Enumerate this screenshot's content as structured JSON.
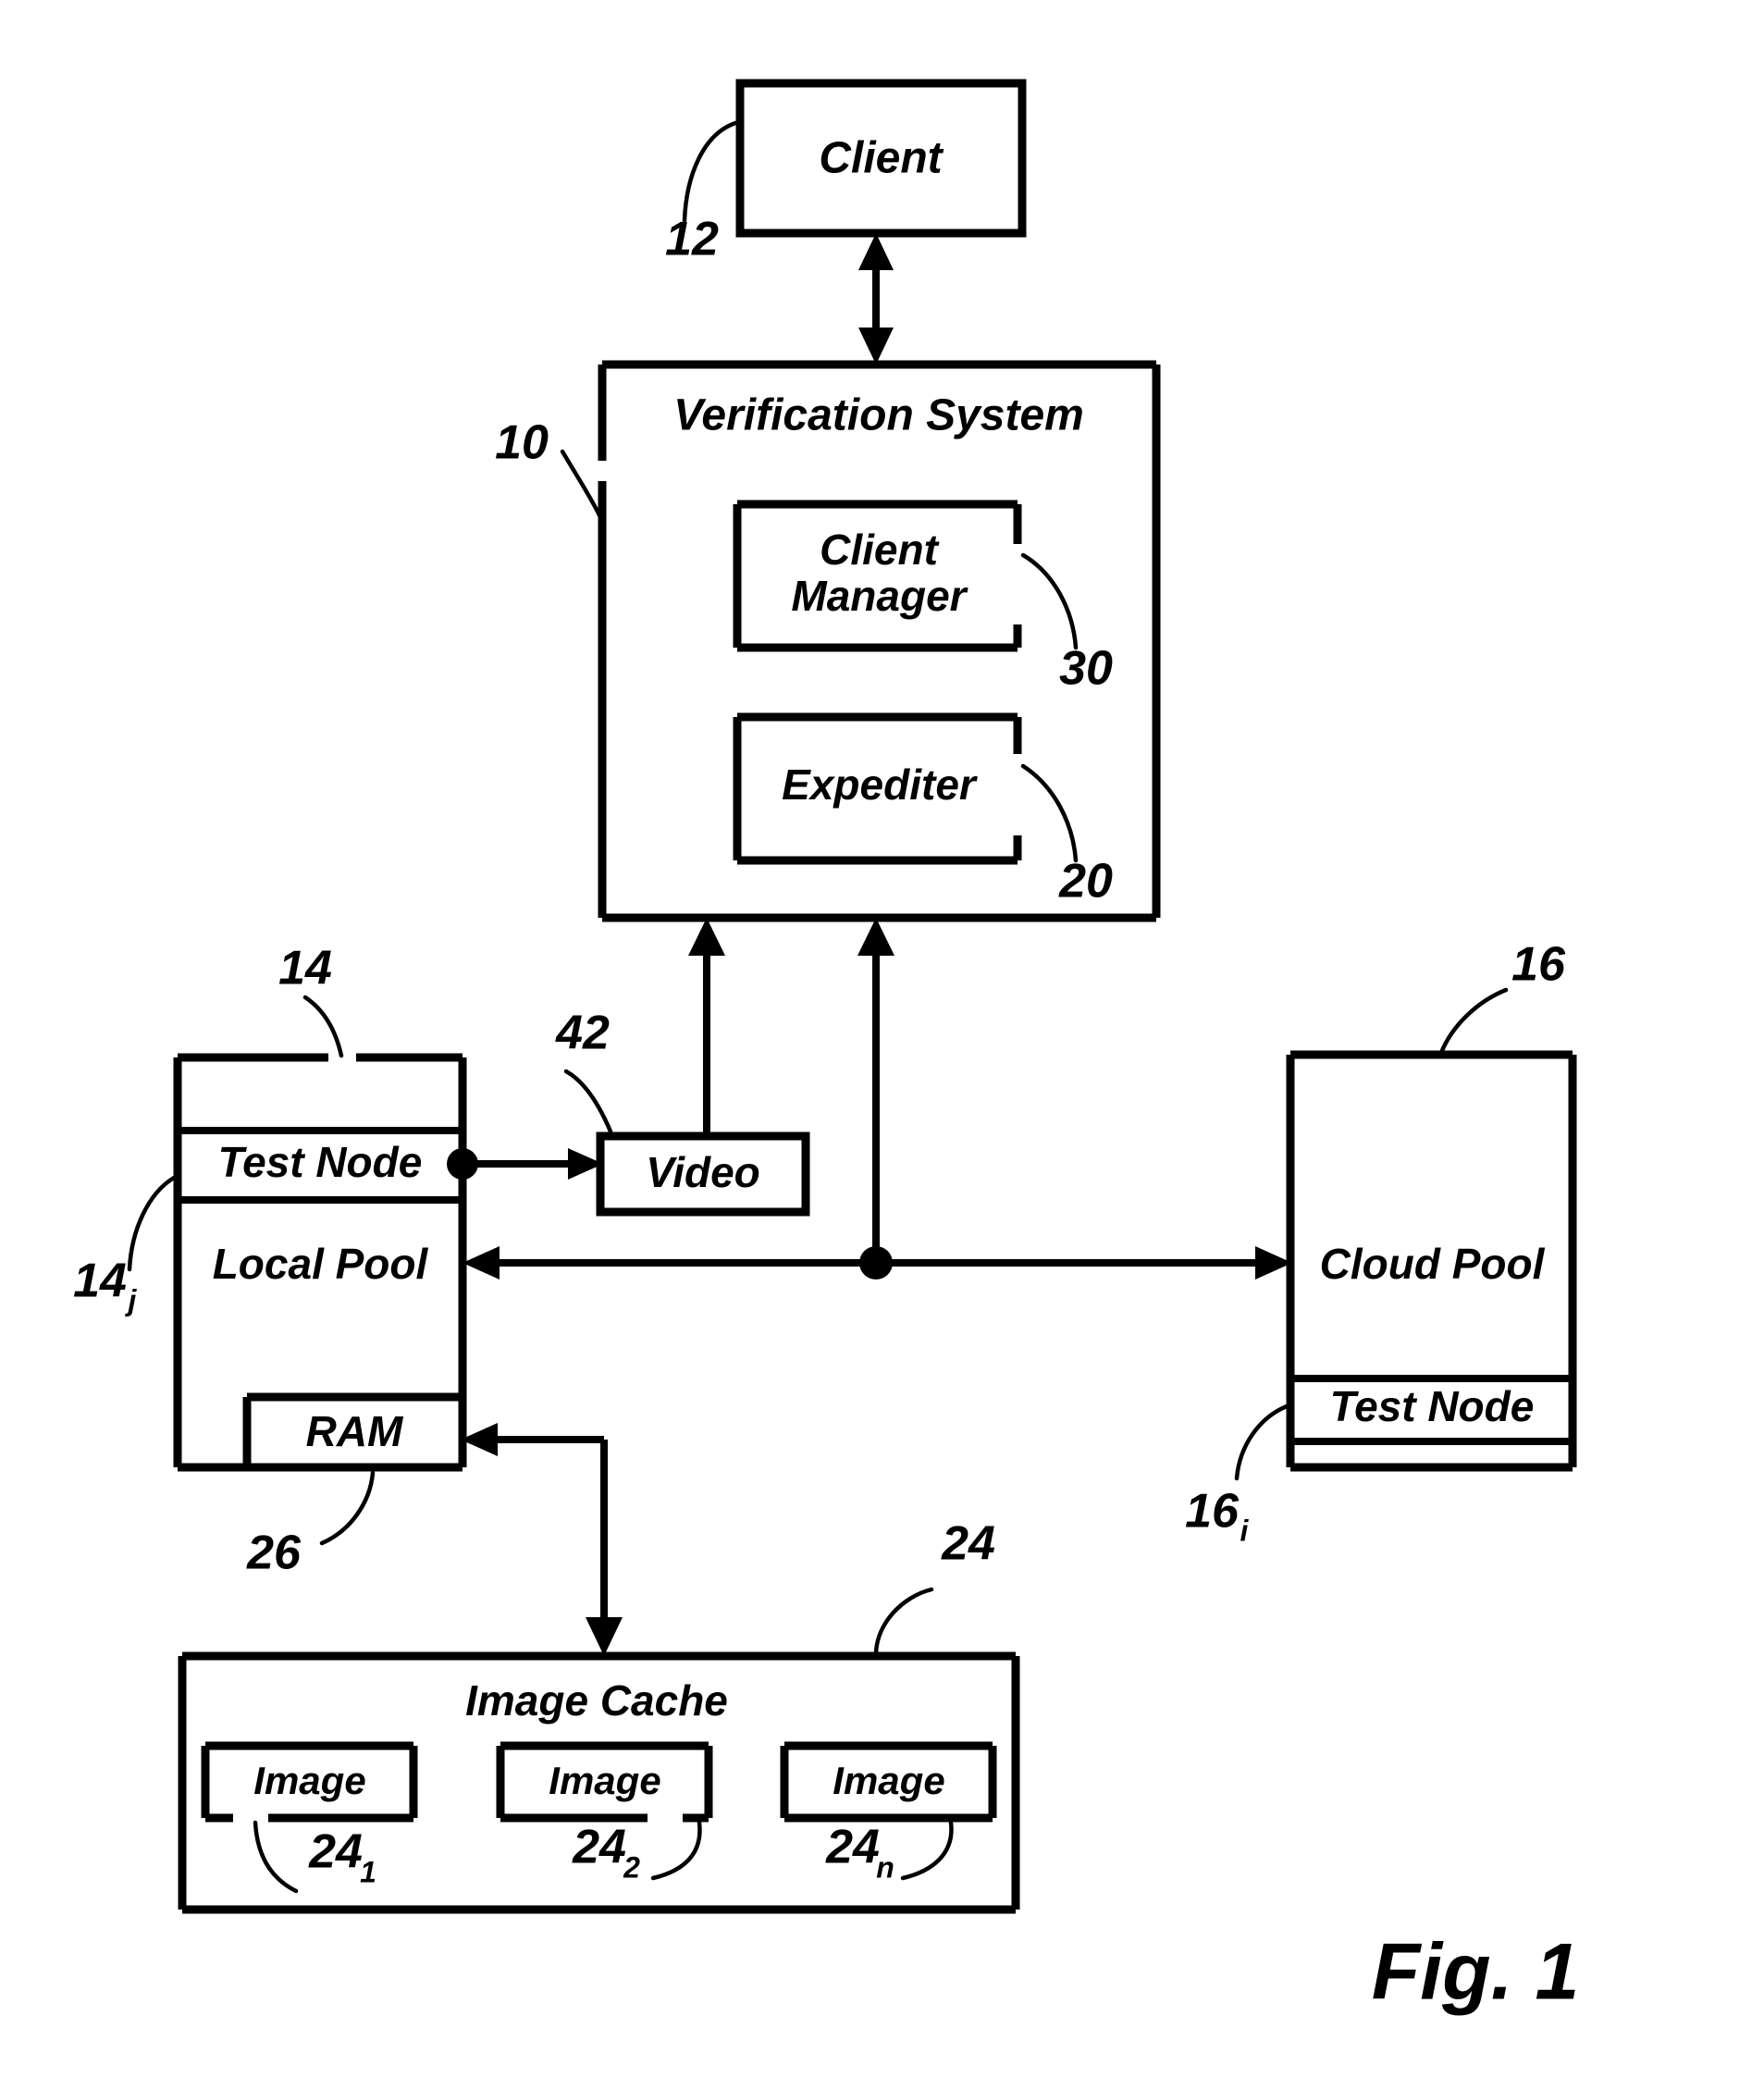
{
  "figure": {
    "caption": "Fig. 1",
    "type": "patent-block-diagram"
  },
  "blocks": {
    "client": {
      "label": "Client",
      "ref": "12"
    },
    "verification_system": {
      "label": "Verification System",
      "ref": "10"
    },
    "client_manager": {
      "label": "Client Manager",
      "label_line1": "Client",
      "label_line2": "Manager",
      "ref": "30"
    },
    "expediter": {
      "label": "Expediter",
      "ref": "20"
    },
    "video": {
      "label": "Video",
      "ref": "42"
    },
    "local_pool_group": {
      "ref": "14",
      "instance_ref": "14",
      "instance_sub": "j"
    },
    "local_pool_test_node": {
      "label": "Test Node"
    },
    "local_pool": {
      "label": "Local Pool"
    },
    "ram": {
      "label": "RAM",
      "ref": "26"
    },
    "cloud_pool_group": {
      "ref": "16",
      "instance_ref": "16",
      "instance_sub": "i"
    },
    "cloud_pool": {
      "label": "Cloud Pool"
    },
    "cloud_pool_test_node": {
      "label": "Test Node"
    },
    "image_cache": {
      "label": "Image Cache",
      "ref": "24"
    },
    "images": [
      {
        "label": "Image",
        "ref": "24",
        "sub": "1"
      },
      {
        "label": "Image",
        "ref": "24",
        "sub": "2"
      },
      {
        "label": "Image",
        "ref": "24",
        "sub": "n"
      }
    ]
  },
  "style": {
    "stroke_color": "#000000",
    "background_color": "#ffffff"
  }
}
